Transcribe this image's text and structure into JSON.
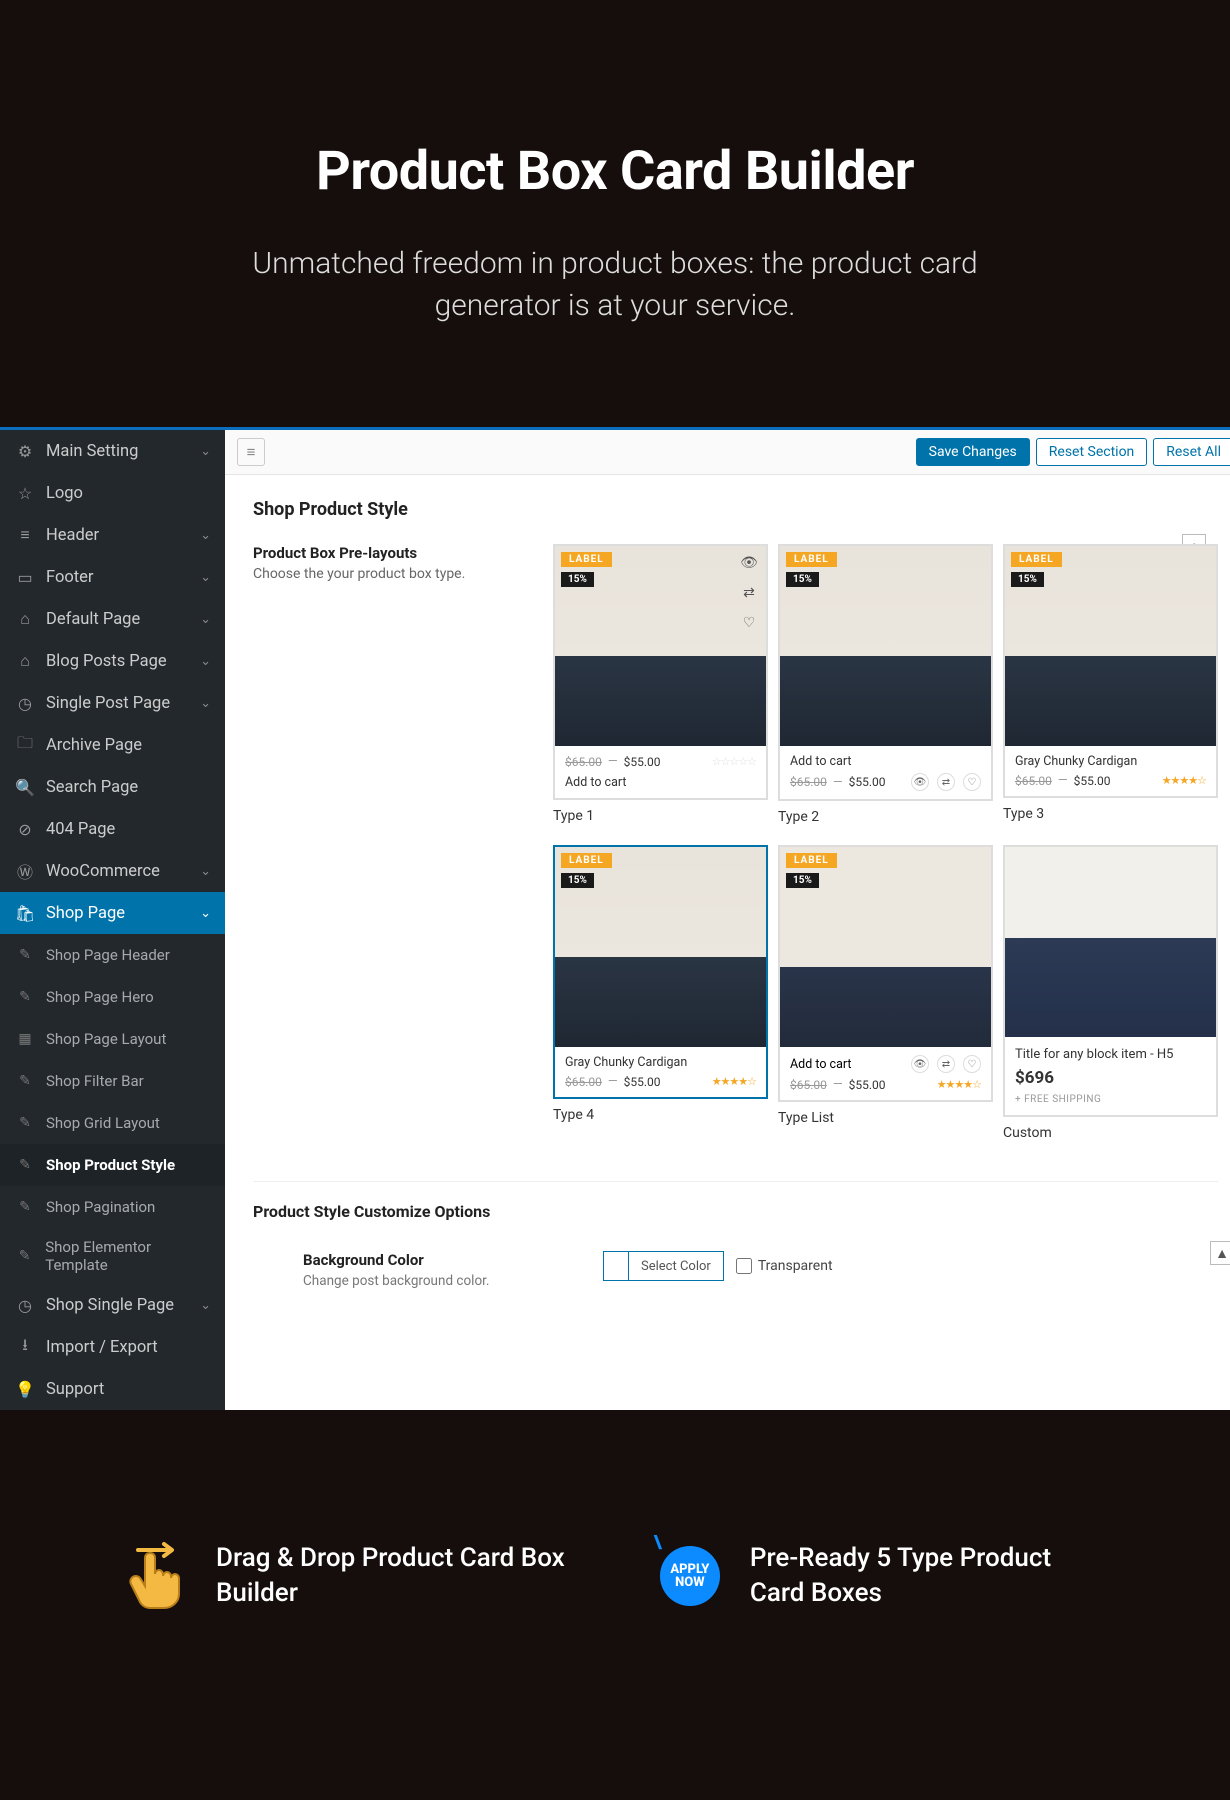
{
  "hero": {
    "title": "Product Box Card Builder",
    "subtitle": "Unmatched freedom in product boxes: the product card generator is at your service."
  },
  "sidebar": {
    "items": [
      {
        "icon": "⚙",
        "label": "Main Setting",
        "chev": true
      },
      {
        "icon": "☆",
        "label": "Logo"
      },
      {
        "icon": "≡",
        "label": "Header",
        "chev": true
      },
      {
        "icon": "▭",
        "label": "Footer",
        "chev": true
      },
      {
        "icon": "⌂",
        "label": "Default Page",
        "chev": true
      },
      {
        "icon": "⌂",
        "label": "Blog Posts Page",
        "chev": true
      },
      {
        "icon": "◷",
        "label": "Single Post Page",
        "chev": true
      },
      {
        "icon": "🗀",
        "label": "Archive Page"
      },
      {
        "icon": "🔍",
        "label": "Search Page"
      },
      {
        "icon": "⊘",
        "label": "404 Page"
      },
      {
        "icon": "Ⓦ",
        "label": "WooCommerce",
        "chev": true
      },
      {
        "icon": "🛍",
        "label": "Shop Page",
        "chev": true,
        "active": true
      }
    ],
    "sub": [
      {
        "label": "Shop Page Header"
      },
      {
        "label": "Shop Page Hero"
      },
      {
        "label": "Shop Page Layout"
      },
      {
        "label": "Shop Filter Bar"
      },
      {
        "label": "Shop Grid Layout"
      },
      {
        "label": "Shop Product Style",
        "active": true
      },
      {
        "label": "Shop Pagination"
      },
      {
        "label": "Shop Elementor Template"
      }
    ],
    "after": [
      {
        "icon": "◷",
        "label": "Shop Single Page",
        "chev": true
      },
      {
        "icon": "⭳",
        "label": "Import / Export"
      },
      {
        "icon": "💡",
        "label": "Support"
      }
    ]
  },
  "topbar": {
    "save": "Save Changes",
    "reset_section": "Reset Section",
    "reset_all": "Reset All"
  },
  "content": {
    "page_title": "Shop Product Style",
    "prelayouts_title": "Product Box Pre-layouts",
    "prelayouts_desc": "Choose the your product box type.",
    "tags": {
      "label": "LABEL",
      "pct": "15%"
    },
    "card": {
      "price_old": "$65.00",
      "dash": "—",
      "price_new": "$55.00",
      "title": "Gray Chunky Cardigan",
      "add_to_cart": "Add to cart"
    },
    "types": {
      "t1": "Type 1",
      "t2": "Type 2",
      "t3": "Type 3",
      "t4": "Type 4",
      "tlist": "Type List",
      "custom": "Custom"
    },
    "custom": {
      "title": "Title for any block item - H5",
      "price": "$696",
      "ship": "+ FREE SHIPPING"
    },
    "customize_heading": "Product Style Customize Options",
    "bg": {
      "title": "Background Color",
      "desc": "Change post background color.",
      "select": "Select Color",
      "transparent": "Transparent"
    }
  },
  "features": {
    "f1": "Drag & Drop Product Card Box Builder",
    "f2": "Pre-Ready 5 Type Product Card Boxes",
    "apply1": "APPLY",
    "apply2": "NOW"
  }
}
